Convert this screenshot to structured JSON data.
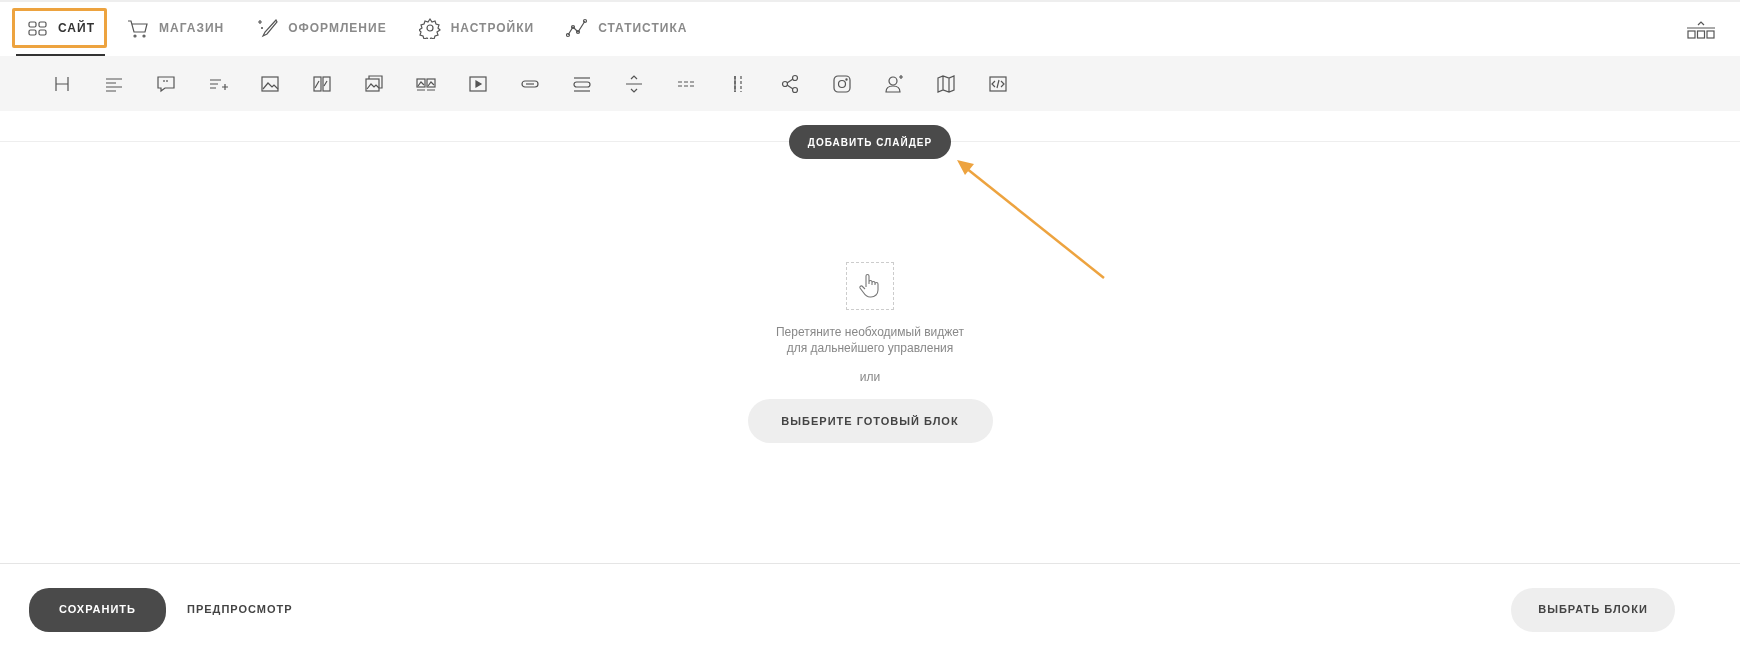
{
  "tabs": [
    {
      "label": "САЙТ",
      "selected": true
    },
    {
      "label": "МАГАЗИН",
      "selected": false
    },
    {
      "label": "ОФОРМЛЕНИЕ",
      "selected": false
    },
    {
      "label": "НАСТРОЙКИ",
      "selected": false
    },
    {
      "label": "СТАТИСТИКА",
      "selected": false
    }
  ],
  "canvas": {
    "add_slider_button": "ДОБАВИТЬ СЛАЙДЕР",
    "hint": "Перетяните необходимый виджет\nдля дальнейшего управления",
    "or": "или",
    "choose_block_button": "ВЫБЕРИТЕ ГОТОВЫЙ БЛОК"
  },
  "footer": {
    "save_button": "СОХРАНИТЬ",
    "preview_link": "ПРЕДПРОСМОТР",
    "select_blocks_button": "ВЫБРАТЬ БЛОКИ"
  }
}
